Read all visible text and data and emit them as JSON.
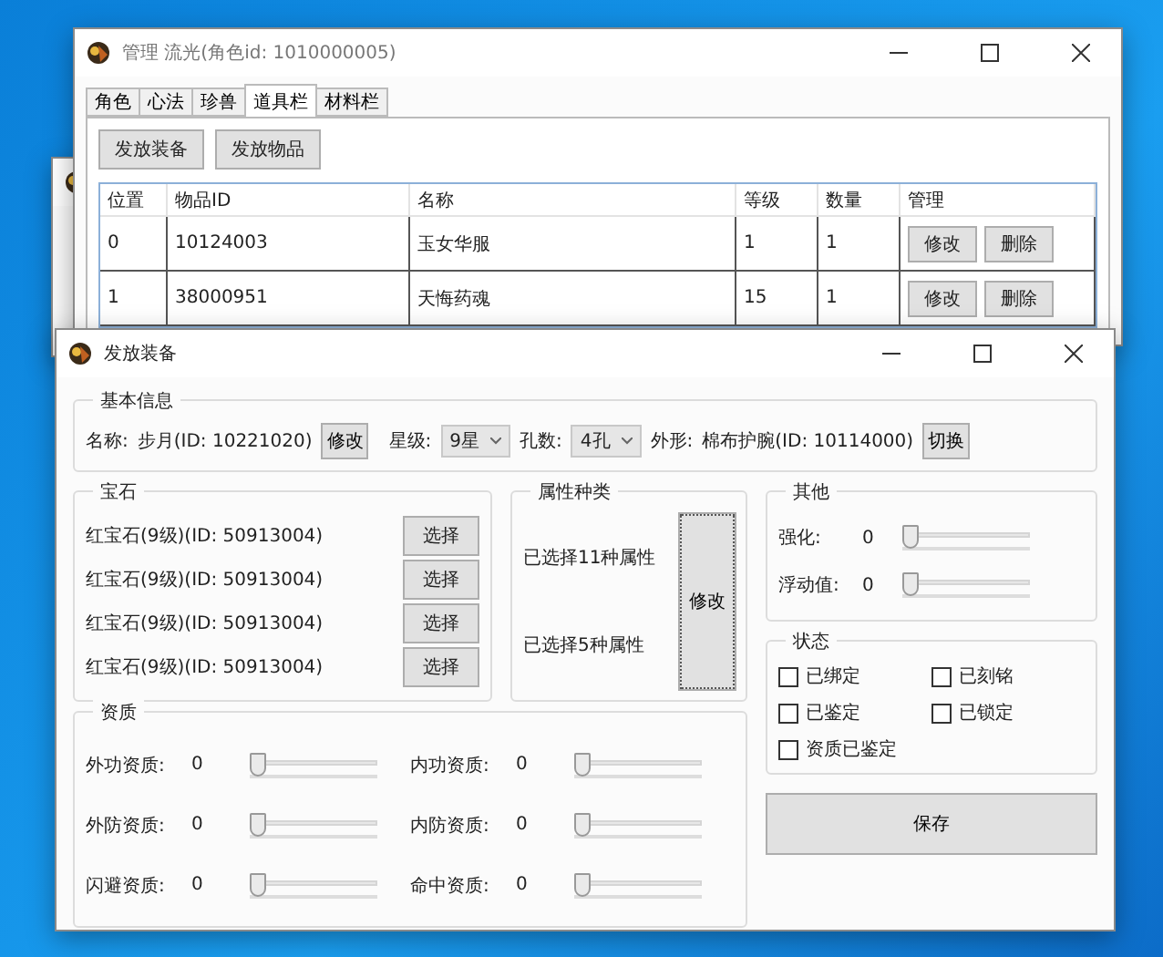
{
  "main_window": {
    "title": "管理 流光(角色id: 1010000005)",
    "tabs": [
      {
        "label": "角色",
        "selected": false
      },
      {
        "label": "心法",
        "selected": false
      },
      {
        "label": "珍兽",
        "selected": false
      },
      {
        "label": "道具栏",
        "selected": true
      },
      {
        "label": "材料栏",
        "selected": false
      }
    ],
    "buttons": [
      "发放装备",
      "发放物品"
    ],
    "table": {
      "columns": [
        "位置",
        "物品ID",
        "名称",
        "等级",
        "数量",
        "管理"
      ],
      "rows": [
        {
          "cells": [
            "0",
            "10124003",
            "玉女华服",
            "1",
            "1"
          ],
          "actions": [
            "修改",
            "删除"
          ]
        },
        {
          "cells": [
            "1",
            "38000951",
            "天悔药魂",
            "15",
            "1"
          ],
          "actions": [
            "修改",
            "删除"
          ]
        }
      ]
    }
  },
  "dialog": {
    "title": "发放装备",
    "basic_info": {
      "title": "基本信息",
      "name_label": "名称:",
      "name_value": "步月(ID: 10221020)",
      "name_button": "修改",
      "star_label": "星级:",
      "star_value": "9星",
      "holes_label": "孔数:",
      "holes_value": "4孔",
      "look_label": "外形:",
      "look_value": "棉布护腕(ID: 10114000)",
      "look_button": "切换"
    },
    "gems": {
      "title": "宝石",
      "items": [
        {
          "name": "红宝石(9级)(ID: 50913004)",
          "button": "选择"
        },
        {
          "name": "红宝石(9级)(ID: 50913004)",
          "button": "选择"
        },
        {
          "name": "红宝石(9级)(ID: 50913004)",
          "button": "选择"
        },
        {
          "name": "红宝石(9级)(ID: 50913004)",
          "button": "选择"
        }
      ]
    },
    "attributes": {
      "title": "属性种类",
      "lines": [
        "已选择11种属性",
        "已选择5种属性"
      ],
      "button": "修改"
    },
    "other": {
      "title": "其他",
      "sliders": [
        {
          "label": "强化:",
          "value": "0",
          "level": 0
        },
        {
          "label": "浮动值:",
          "value": "0",
          "level": 0
        }
      ]
    },
    "status": {
      "title": "状态",
      "checkboxes": [
        {
          "label": "已绑定",
          "checked": false
        },
        {
          "label": "已刻铭",
          "checked": false
        },
        {
          "label": "已鉴定",
          "checked": false
        },
        {
          "label": "已锁定",
          "checked": false
        },
        {
          "label": "资质已鉴定",
          "checked": false
        }
      ]
    },
    "aptitude": {
      "title": "资质",
      "sliders": [
        {
          "label": "外功资质:",
          "value": "0",
          "level": 0
        },
        {
          "label": "内功资质:",
          "value": "0",
          "level": 0
        },
        {
          "label": "外防资质:",
          "value": "0",
          "level": 0
        },
        {
          "label": "内防资质:",
          "value": "0",
          "level": 0
        },
        {
          "label": "闪避资质:",
          "value": "0",
          "level": 0
        },
        {
          "label": "命中资质:",
          "value": "0",
          "level": 0
        }
      ]
    },
    "save_button": "保存"
  }
}
